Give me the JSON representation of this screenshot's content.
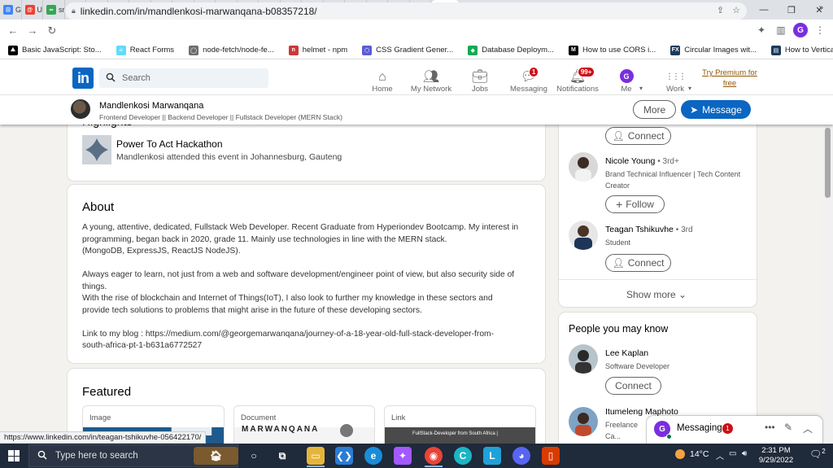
{
  "browser": {
    "tabs": [
      {
        "label": "Gc",
        "color": "#4285f4",
        "glyph": "⊡"
      },
      {
        "label": "Ur",
        "color": "#e94235",
        "glyph": "@"
      },
      {
        "label": "sn",
        "color": "#33a852",
        "glyph": "∞"
      },
      {
        "label": "Br",
        "color": "#d93a7a",
        "glyph": "●"
      },
      {
        "label": "Fc",
        "color": "#d93a7a",
        "glyph": "●"
      },
      {
        "label": "fo",
        "color": "#1b3a5c",
        "glyph": "▣"
      },
      {
        "label": "CS",
        "color": "#5b5bd6",
        "glyph": "⬡"
      },
      {
        "label": "'C",
        "color": "#2f6db5",
        "glyph": "/"
      },
      {
        "label": "Cl",
        "color": "#202124",
        "glyph": "◎"
      },
      {
        "label": "Lo",
        "color": "#f4a340",
        "glyph": "C"
      },
      {
        "label": "fa",
        "color": "#6e6e6e",
        "glyph": "◯"
      },
      {
        "label": "Cc",
        "color": "#333333",
        "glyph": "cv"
      },
      {
        "label": "Cs",
        "color": "#e6a23c",
        "glyph": "⚐"
      },
      {
        "label": "re",
        "color": "#000000",
        "glyph": "M"
      },
      {
        "label": "re",
        "color": "#000000",
        "glyph": "M"
      },
      {
        "label": "Le",
        "color": "#000000",
        "glyph": "M"
      },
      {
        "label": "To",
        "color": "#000000",
        "glyph": "M"
      },
      {
        "label": "W",
        "color": "#000000",
        "glyph": "A"
      },
      {
        "label": "W",
        "color": "#000000",
        "glyph": "A"
      },
      {
        "label": "Re",
        "color": "#000000",
        "glyph": "A"
      }
    ],
    "active_tab_glyph": "in",
    "url": "linkedin.com/in/mandlenkosi-marwanqana-b08357218/",
    "bookmarks": [
      {
        "label": "Basic JavaScript: Sto...",
        "color": "#000000",
        "glyph": "⛰"
      },
      {
        "label": "React Forms",
        "color": "#61dafb",
        "glyph": "⚛"
      },
      {
        "label": "node-fetch/node-fe...",
        "color": "#6e6e6e",
        "glyph": "◯"
      },
      {
        "label": "helmet - npm",
        "color": "#cb3837",
        "glyph": "n"
      },
      {
        "label": "CSS Gradient Gener...",
        "color": "#5b5bd6",
        "glyph": "⬡"
      },
      {
        "label": "Database Deploym...",
        "color": "#13aa52",
        "glyph": "◆"
      },
      {
        "label": "How to use CORS i...",
        "color": "#000000",
        "glyph": "M"
      },
      {
        "label": "Circular Images wit...",
        "color": "#1b3a5c",
        "glyph": "FX"
      },
      {
        "label": "How to Vertically Al...",
        "color": "#1b3a5c",
        "glyph": "▤"
      }
    ],
    "bookmarks_more": "»",
    "profile_initial": "G"
  },
  "linkedin": {
    "logo": "in",
    "search_placeholder": "Search",
    "nav": [
      {
        "label": "Home",
        "icon": "home-icon",
        "badge": ""
      },
      {
        "label": "My Network",
        "icon": "network-icon",
        "badge": ""
      },
      {
        "label": "Jobs",
        "icon": "jobs-icon",
        "badge": ""
      },
      {
        "label": "Messaging",
        "icon": "messaging-icon",
        "badge": "1"
      },
      {
        "label": "Notifications",
        "icon": "bell-icon",
        "badge": "99+"
      },
      {
        "label": "Me",
        "icon": "me-icon",
        "badge": ""
      },
      {
        "label": "Work",
        "icon": "grid-icon",
        "badge": ""
      }
    ],
    "me_initial": "G",
    "premium_line1": "Try Premium for",
    "premium_line2": "free"
  },
  "profile": {
    "name": "Mandlenkosi Marwanqana",
    "headline": "Frontend Developer || Backend Developer || Fullstack Developer (MERN Stack)",
    "more_label": "More",
    "message_label": "Message"
  },
  "highlights": {
    "heading": "Highlights",
    "title": "Power To Act Hackathon",
    "subtitle": "Mandlenkosi attended this event in Johannesburg, Gauteng"
  },
  "about": {
    "heading": "About",
    "lines": [
      "A young, attentive, dedicated, Fullstack Web Developer. Recent Graduate from Hyperiondev Bootcamp. My interest in",
      "programming, began back in 2020, grade 11. Mainly use technologies in line with the MERN stack.",
      "(MongoDB, ExpressJS, ReactJS NodeJS).",
      "",
      "Always eager to learn, not just from a web and software development/engineer point of view, but also security side of",
      "things.",
      "With the rise of blockchain and Internet of Things(IoT), I also look to further my knowledge in these sectors and",
      "provide tech solutions to problems that might arise in the future of these developing sectors.",
      "",
      "Link to my blog : https://medium.com/@georgemarwanqana/journey-of-a-18-year-old-full-stack-developer-from-",
      "south-africa-pt-1-b631a6772527"
    ]
  },
  "featured": {
    "heading": "Featured",
    "items": [
      {
        "label": "Image",
        "preview_text": ""
      },
      {
        "label": "Document",
        "preview_text": "MARWANQANA"
      },
      {
        "label": "Link",
        "preview_text": "FullStack-Developer from South Africa |"
      }
    ]
  },
  "right_connections": [
    {
      "name": "",
      "degree": "",
      "sub": "",
      "action": "Connect"
    },
    {
      "name": "Nicole Young",
      "degree": "• 3rd+",
      "sub": "Brand Technical Influencer | Tech Content Creator",
      "action": "Follow"
    },
    {
      "name": "Teagan Tshikuvhe",
      "degree": "• 3rd",
      "sub": "Student",
      "action": "Connect"
    }
  ],
  "show_more": "Show more",
  "pymk": {
    "heading": "People you may know",
    "people": [
      {
        "name": "Lee Kaplan",
        "sub": "Software Developer",
        "action": "Connect"
      },
      {
        "name": "Itumeleng Maphoto",
        "sub": "Freelance Ca... Television",
        "action": ""
      }
    ]
  },
  "messaging": {
    "label": "Messaging",
    "initial": "G",
    "badge": "1"
  },
  "status_url": "https://www.linkedin.com/in/teagan-tshikuvhe-056422170/",
  "taskbar": {
    "search_placeholder": "Type here to search",
    "weather": "14°C",
    "time": "2:31 PM",
    "date": "9/29/2022",
    "notif_count": "2"
  }
}
